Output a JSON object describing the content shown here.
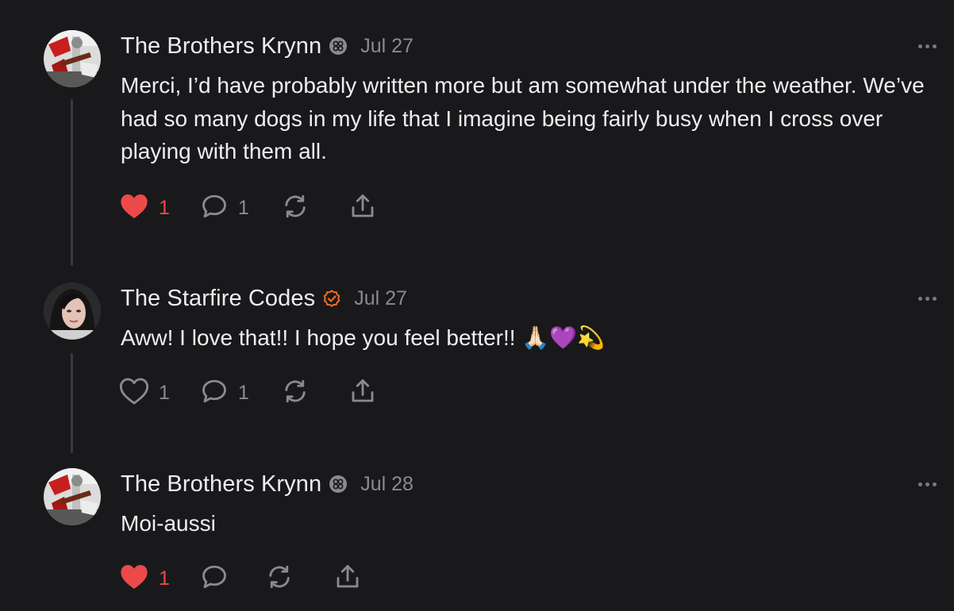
{
  "colors": {
    "background": "#19191b",
    "liked_heart": "#ec4a4a",
    "verified_badge": "#f26b22",
    "muted_text": "#8a8a8f"
  },
  "comments": [
    {
      "author": "The Brothers Krynn",
      "badge": "subscriber-badge-icon",
      "date": "Jul 27",
      "body": "Merci, I’d have probably written more but am somewhat under the weather. We’ve had so many dogs in my life that I imagine being fairly busy when I cross over playing with them all.",
      "liked": true,
      "likes": "1",
      "replies": "1"
    },
    {
      "author": "The Starfire Codes",
      "badge": "verified-check-icon",
      "date": "Jul 27",
      "body": "Aww! I love that!! I hope you feel better!! 🙏🏻💜💫",
      "liked": false,
      "likes": "1",
      "replies": "1"
    },
    {
      "author": "The Brothers Krynn",
      "badge": "subscriber-badge-icon",
      "date": "Jul 28",
      "body": "Moi-aussi",
      "liked": true,
      "likes": "1",
      "replies": ""
    }
  ]
}
